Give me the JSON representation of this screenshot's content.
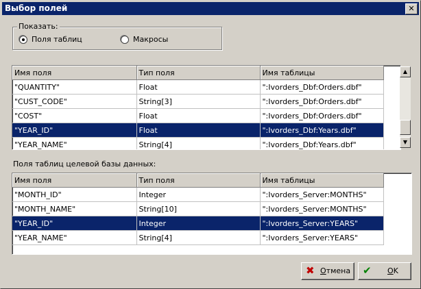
{
  "window": {
    "title": "Выбор полей",
    "close_glyph": "✕"
  },
  "show_group": {
    "legend": "Показать:",
    "options": [
      {
        "label": "Поля таблиц",
        "selected": true
      },
      {
        "label": "Макросы",
        "selected": false
      }
    ]
  },
  "source_grid": {
    "columns": [
      "Имя поля",
      "Тип поля",
      "Имя таблицы"
    ],
    "rows": [
      {
        "field": "\"QUANTITY\"",
        "type": "Float",
        "table": "\":Ivorders_Dbf:Orders.dbf\"",
        "selected": false
      },
      {
        "field": "\"CUST_CODE\"",
        "type": "String[3]",
        "table": "\":Ivorders_Dbf:Orders.dbf\"",
        "selected": false
      },
      {
        "field": "\"COST\"",
        "type": "Float",
        "table": "\":Ivorders_Dbf:Orders.dbf\"",
        "selected": false
      },
      {
        "field": "\"YEAR_ID\"",
        "type": "Float",
        "table": "\":Ivorders_Dbf:Years.dbf\"",
        "selected": true
      },
      {
        "field": "\"YEAR_NAME\"",
        "type": "String[4]",
        "table": "\":Ivorders_Dbf:Years.dbf\"",
        "selected": false
      }
    ]
  },
  "target_label": "Поля таблиц целевой базы данных:",
  "target_grid": {
    "columns": [
      "Имя поля",
      "Тип поля",
      "Имя таблицы"
    ],
    "rows": [
      {
        "field": "\"MONTH_ID\"",
        "type": "Integer",
        "table": "\":Ivorders_Server:MONTHS\"",
        "selected": false
      },
      {
        "field": "\"MONTH_NAME\"",
        "type": "String[10]",
        "table": "\":Ivorders_Server:MONTHS\"",
        "selected": false
      },
      {
        "field": "\"YEAR_ID\"",
        "type": "Integer",
        "table": "\":Ivorders_Server:YEARS\"",
        "selected": true
      },
      {
        "field": "\"YEAR_NAME\"",
        "type": "String[4]",
        "table": "\":Ivorders_Server:YEARS\"",
        "selected": false
      }
    ]
  },
  "buttons": {
    "cancel": {
      "label": "Отмена",
      "accel": "О",
      "rest": "тмена",
      "icon": "x-icon",
      "icon_color": "#c00000"
    },
    "ok": {
      "label": "OK",
      "accel": "O",
      "rest": "K",
      "icon": "check-icon",
      "icon_color": "#008000"
    }
  },
  "colors": {
    "titlebar": "#0a246a",
    "selection": "#0a246a",
    "face": "#d4d0c8"
  }
}
